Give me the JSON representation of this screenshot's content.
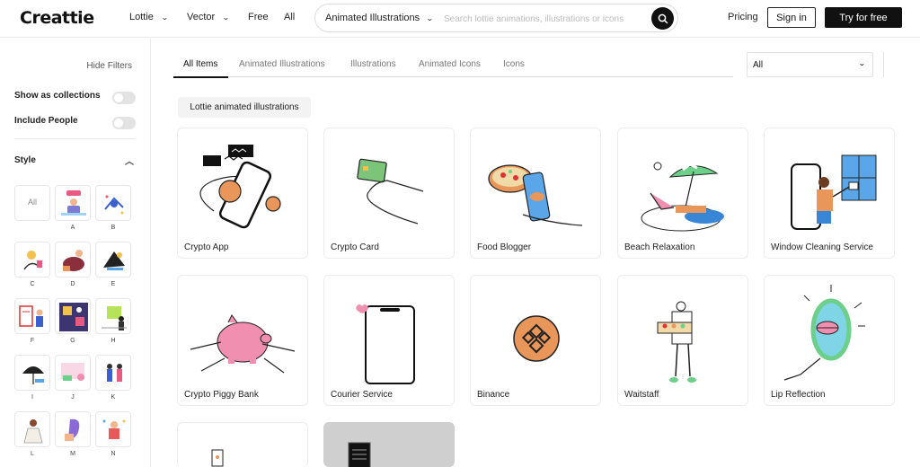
{
  "header": {
    "logo": "Creattie",
    "nav": [
      {
        "label": "Lottie",
        "has_dropdown": true
      },
      {
        "label": "Vector",
        "has_dropdown": true
      },
      {
        "label": "Free",
        "has_dropdown": false
      },
      {
        "label": "All",
        "has_dropdown": false
      }
    ],
    "search": {
      "type_label": "Animated Illustrations",
      "placeholder": "Search lottie animations, illustrations or icons",
      "icon": "search-icon"
    },
    "pricing": "Pricing",
    "sign_in": "Sign in",
    "try_free": "Try for free"
  },
  "sidebar": {
    "hide_filters": "Hide Filters",
    "show_collections": "Show as collections",
    "include_people": "Include People",
    "style_heading": "Style",
    "style_all": "All",
    "styles": [
      "A",
      "B",
      "C",
      "D",
      "E",
      "F",
      "G",
      "H",
      "I",
      "J",
      "K",
      "L",
      "M",
      "N"
    ]
  },
  "main": {
    "tabs": [
      "All Items",
      "Animated Illustrations",
      "Illustrations",
      "Animated Icons",
      "Icons"
    ],
    "active_tab": "All Items",
    "filter_value": "All",
    "chip": "Lottie animated illustrations",
    "cards": [
      "Crypto App",
      "Crypto Card",
      "Food Blogger",
      "Beach Relaxation",
      "Window Cleaning Service",
      "Crypto Piggy Bank",
      "Courier Service",
      "Binance",
      "Waitstaff",
      "Lip Reflection"
    ]
  },
  "colors": {
    "accent": "#111111",
    "orange": "#e8965a",
    "pink": "#f08fb0",
    "blue": "#5aa6e8",
    "green": "#6ccf8a"
  }
}
